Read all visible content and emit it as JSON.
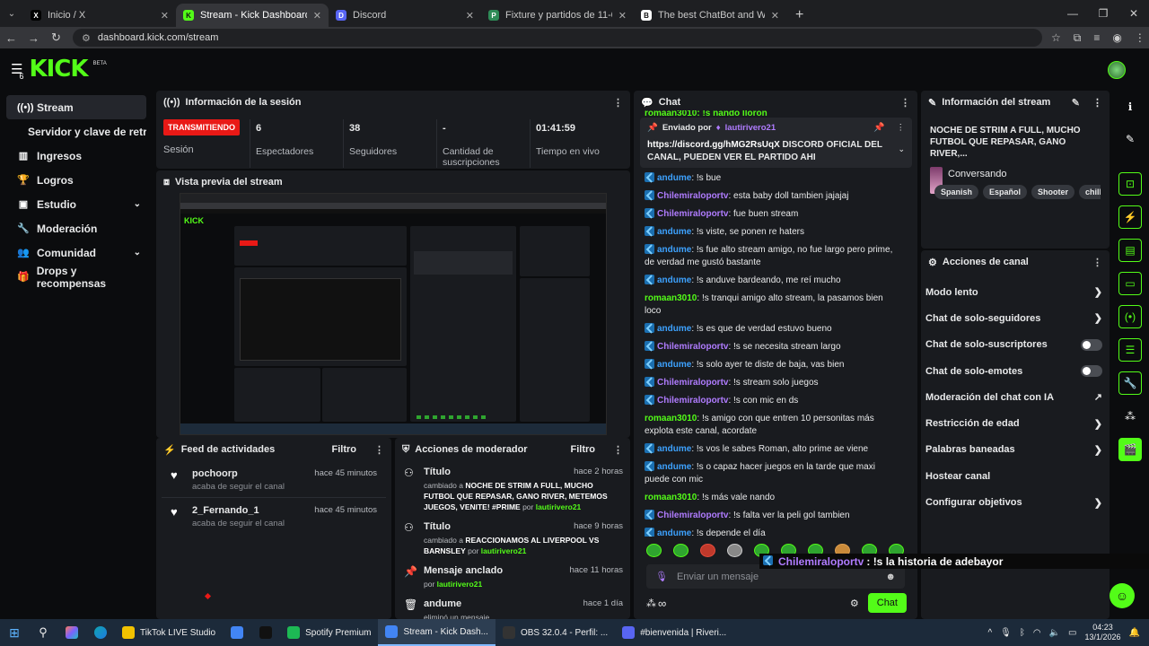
{
  "browser": {
    "tabs": [
      {
        "title": "Inicio / X",
        "icon": "x-logo-icon",
        "active": false
      },
      {
        "title": "Stream - Kick Dashboard",
        "icon": "kick-logo-icon",
        "active": true
      },
      {
        "title": "Discord",
        "icon": "discord-logo-icon",
        "active": false
      },
      {
        "title": "Fixture y partidos de 11-01-202",
        "icon": "promiedos-icon",
        "active": false
      },
      {
        "title": "The best ChatBot and Widgets",
        "icon": "botrix-icon",
        "active": false
      }
    ],
    "url": "dashboard.kick.com/stream"
  },
  "header": {
    "logo": "KICK",
    "beta": "BETA",
    "notif_count": "6"
  },
  "sidebar": {
    "items": [
      {
        "label": "Stream",
        "icon": "broadcast-icon",
        "active": true,
        "chevron": false
      },
      {
        "label": "Servidor y clave de retransmisión",
        "icon": "",
        "sub": true
      },
      {
        "label": "Ingresos",
        "icon": "chart-icon",
        "chevron": false
      },
      {
        "label": "Logros",
        "icon": "trophy-icon",
        "chevron": false
      },
      {
        "label": "Estudio",
        "icon": "layout-icon",
        "chevron": true
      },
      {
        "label": "Moderación",
        "icon": "wrench-icon",
        "chevron": false
      },
      {
        "label": "Comunidad",
        "icon": "users-icon",
        "chevron": true
      },
      {
        "label": "Drops y recompensas",
        "icon": "gift-icon",
        "chevron": false
      }
    ]
  },
  "session": {
    "title": "Información de la sesión",
    "live_badge": "TRANSMITIENDO",
    "status_label": "Sesión",
    "stats": [
      {
        "value": "6",
        "label": "Espectadores"
      },
      {
        "value": "38",
        "label": "Seguidores"
      },
      {
        "value": "-",
        "label": "Cantidad de suscripciones"
      },
      {
        "value": "01:41:59",
        "label": "Tiempo en vivo"
      }
    ]
  },
  "preview": {
    "title": "Vista previa del stream"
  },
  "feed": {
    "title": "Feed de actividades",
    "filter": "Filtro",
    "items": [
      {
        "user": "pochoorp",
        "action": "acaba de seguir el canal",
        "time": "hace 45 minutos"
      },
      {
        "user": "2_Fernando_1",
        "action": "acaba de seguir el canal",
        "time": "hace 45 minutos"
      }
    ]
  },
  "mod": {
    "title": "Acciones de moderador",
    "filter": "Filtro",
    "items": [
      {
        "title": "Título",
        "time": "hace 2 horas",
        "pre": "cambiado a ",
        "bold": "NOCHE DE STRIM A FULL, MUCHO FUTBOL QUE REPASAR, GANO RIVER, METEMOS JUEGOS, VENITE! #PRIME",
        "by": " por ",
        "user": "lautirivero21"
      },
      {
        "title": "Título",
        "time": "hace 9 horas",
        "pre": "cambiado a ",
        "bold": "REACCIONAMOS AL LIVERPOOL VS BARNSLEY",
        "by": " por ",
        "user": "lautirivero21"
      },
      {
        "title": "Mensaje anclado",
        "time": "hace 11 horas",
        "pre": "",
        "bold": "",
        "by": "por ",
        "user": "lautirivero21"
      },
      {
        "title": "andume",
        "time": "hace 1 día",
        "pre": "eliminó un mensaje",
        "bold": "",
        "by": "",
        "user": ""
      }
    ]
  },
  "chat": {
    "title": "Chat",
    "top_partial": "romaan3010: !s nando lloron",
    "pinned": {
      "label": "Enviado por",
      "user": "lautirivero21",
      "link": "https://discord.gg/hMG2RsUqX",
      "text": " DISCORD OFICIAL DEL CANAL, PUEDEN VER EL PARTIDO AHI"
    },
    "messages": [
      {
        "user": "andume",
        "color": "blue",
        "badge": true,
        "text": "!s bue"
      },
      {
        "user": "Chilemiraloportv",
        "color": "purple",
        "badge": true,
        "text": "esta baby doll tambien jajajaj"
      },
      {
        "user": "Chilemiraloportv",
        "color": "purple",
        "badge": true,
        "text": "fue buen stream"
      },
      {
        "user": "andume",
        "color": "blue",
        "badge": true,
        "text": "!s viste, se ponen re haters"
      },
      {
        "user": "andume",
        "color": "blue",
        "badge": true,
        "text": "!s fue alto stream amigo, no fue largo pero prime, de verdad me gustó bastante"
      },
      {
        "user": "andume",
        "color": "blue",
        "badge": true,
        "text": "!s anduve bardeando, me reí mucho"
      },
      {
        "user": "romaan3010",
        "color": "green",
        "badge": false,
        "text": "!s tranqui amigo alto stream, la pasamos bien loco"
      },
      {
        "user": "andume",
        "color": "blue",
        "badge": true,
        "text": "!s es que de verdad estuvo bueno"
      },
      {
        "user": "Chilemiraloportv",
        "color": "purple",
        "badge": true,
        "text": "!s se necesita stream largo"
      },
      {
        "user": "andume",
        "color": "blue",
        "badge": true,
        "text": "!s solo ayer te diste de baja, vas bien"
      },
      {
        "user": "Chilemiraloportv",
        "color": "purple",
        "badge": true,
        "text": "!s stream solo juegos"
      },
      {
        "user": "Chilemiraloportv",
        "color": "purple",
        "badge": true,
        "text": "!s con mic en ds"
      },
      {
        "user": "romaan3010",
        "color": "green",
        "badge": false,
        "text": "!s amigo con que entren 10 personitas más explota este canal, acordate"
      },
      {
        "user": "andume",
        "color": "blue",
        "badge": true,
        "text": "!s vos le sabes Roman, alto prime ae viene"
      },
      {
        "user": "andume",
        "color": "blue",
        "badge": true,
        "text": "!s o capaz hacer juegos en la tarde que maxi puede con mic"
      },
      {
        "user": "romaan3010",
        "color": "green",
        "badge": false,
        "text": "!s más vale nando"
      },
      {
        "user": "Chilemiraloportv",
        "color": "purple",
        "badge": true,
        "text": "!s falta ver la peli gol tambien"
      },
      {
        "user": "andume",
        "color": "blue",
        "badge": true,
        "text": "!s depende el día"
      },
      {
        "user": "Chilemiraloportv",
        "color": "purple",
        "badge": true,
        "text": "!s la historia de adebayor"
      }
    ],
    "placeholder": "Enviar un mensaje",
    "send_label": "Chat",
    "points": "∞",
    "tooltip_user": "Chilemiraloportv",
    "tooltip_text": ": !s la historia de adebayor"
  },
  "stream_info": {
    "title": "Información del stream",
    "stream_title": "NOCHE DE STRIM A FULL, MUCHO FUTBOL QUE REPASAR, GANO RIVER,...",
    "category": "Conversando",
    "tags": [
      "Spanish",
      "Español",
      "Shooter",
      "chill"
    ]
  },
  "actions": {
    "title": "Acciones de canal",
    "rows": [
      {
        "label": "Modo lento",
        "control": "chevron"
      },
      {
        "label": "Chat de solo-seguidores",
        "control": "chevron"
      },
      {
        "label": "Chat de solo-suscriptores",
        "control": "toggle"
      },
      {
        "label": "Chat de solo-emotes",
        "control": "toggle"
      },
      {
        "label": "Moderación del chat con IA",
        "control": "external"
      },
      {
        "label": "Restricción de edad",
        "control": "chevron"
      },
      {
        "label": "Palabras baneadas",
        "control": "chevron"
      },
      {
        "label": "Hostear canal",
        "control": "none"
      },
      {
        "label": "Configurar objetivos",
        "control": "chevron"
      }
    ]
  },
  "taskbar": {
    "apps": [
      {
        "label": "TikTok LIVE Studio",
        "color": "#f2c200",
        "active": false
      },
      {
        "label": "",
        "color": "#4285f4",
        "active": false
      },
      {
        "label": "",
        "color": "#111111",
        "active": false
      },
      {
        "label": "Spotify Premium",
        "color": "#1db954",
        "active": false
      },
      {
        "label": "Stream - Kick Dash...",
        "color": "#4285f4",
        "active": true
      },
      {
        "label": "OBS 32.0.4 - Perfil: ...",
        "color": "#333333",
        "active": false
      },
      {
        "label": "#bienvenida | Riveri...",
        "color": "#5865f2",
        "active": false
      }
    ],
    "time": "04:23",
    "date": "13/1/2026"
  }
}
